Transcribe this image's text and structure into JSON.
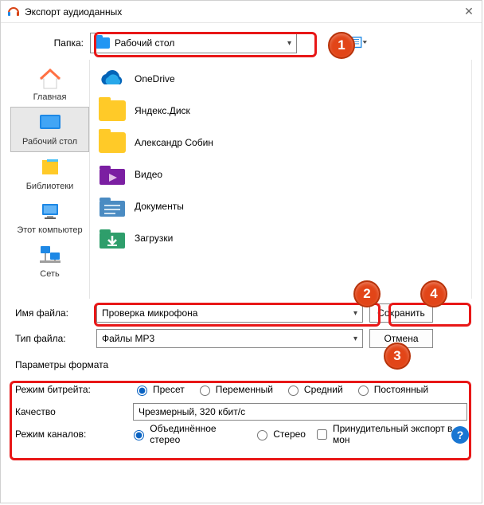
{
  "title": "Экспорт аудиоданных",
  "toprow": {
    "label": "Папка:",
    "value": "Рабочий стол"
  },
  "sidebar": [
    {
      "label": "Главная"
    },
    {
      "label": "Рабочий стол"
    },
    {
      "label": "Библиотеки"
    },
    {
      "label": "Этот компьютер"
    },
    {
      "label": "Сеть"
    }
  ],
  "files": [
    {
      "label": "OneDrive"
    },
    {
      "label": "Яндекс.Диск"
    },
    {
      "label": "Александр Собин"
    },
    {
      "label": "Видео"
    },
    {
      "label": "Документы"
    },
    {
      "label": "Загрузки"
    }
  ],
  "filename": {
    "label": "Имя файла:",
    "value": "Проверка микрофона"
  },
  "filetype": {
    "label": "Тип файла:",
    "value": "Файлы MP3"
  },
  "buttons": {
    "save": "Сохранить",
    "cancel": "Отмена"
  },
  "format": {
    "heading": "Параметры формата",
    "bitrate_label": "Режим битрейта:",
    "bitrate_opts": [
      "Пресет",
      "Переменный",
      "Средний",
      "Постоянный"
    ],
    "quality_label": "Качество",
    "quality_value": "Чрезмерный, 320 кбит/с",
    "channel_label": "Режим каналов:",
    "channel_opts": [
      "Объединённое стерео",
      "Стерео"
    ],
    "force_mono": "Принудительный экспорт в мон"
  },
  "badges": {
    "b1": "1",
    "b2": "2",
    "b3": "3",
    "b4": "4"
  }
}
